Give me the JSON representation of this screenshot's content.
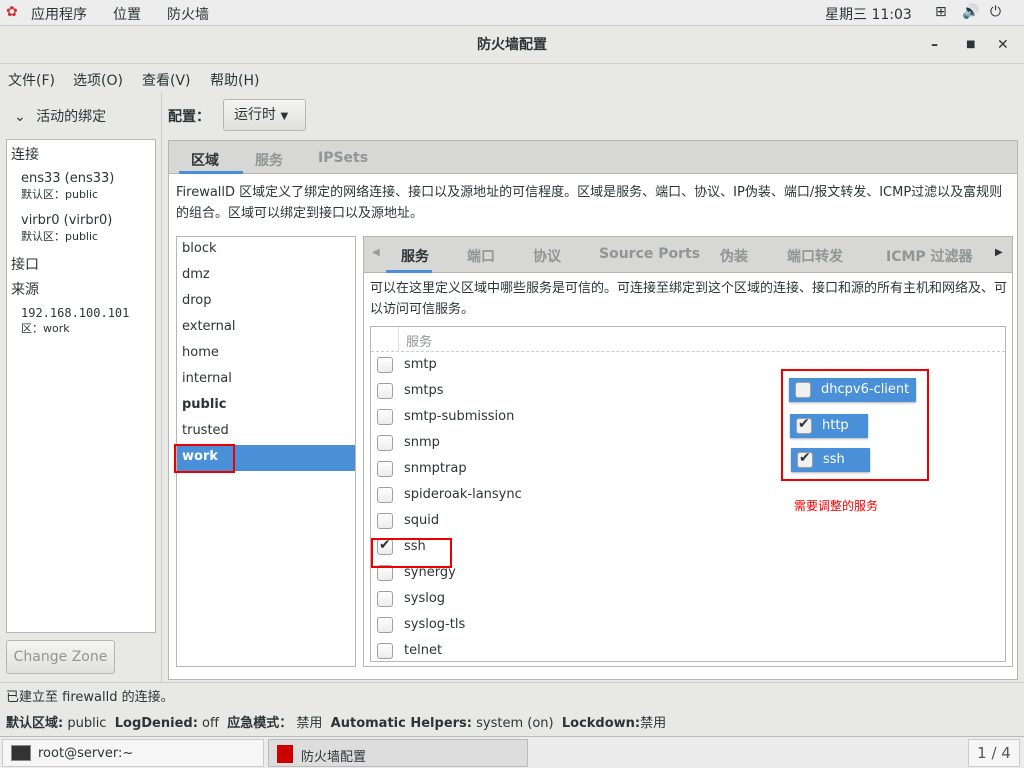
{
  "topbar": {
    "apps": "应用程序",
    "places": "位置",
    "app_name": "防火墙",
    "clock": "星期三 11:03"
  },
  "window": {
    "title": "防火墙配置"
  },
  "menu": [
    "文件(F)",
    "选项(O)",
    "查看(V)",
    "帮助(H)"
  ],
  "left": {
    "header": "活动的绑定",
    "connections_label": "连接",
    "connections": [
      {
        "name": "ens33 (ens33)",
        "zone": "默认区：public"
      },
      {
        "name": "virbr0 (virbr0)",
        "zone": "默认区：public"
      }
    ],
    "interfaces_label": "接口",
    "sources_label": "来源",
    "sources": [
      {
        "name": "192.168.100.101",
        "zone": "区：work"
      }
    ],
    "change_zone": "Change Zone"
  },
  "config": {
    "label": "配置：",
    "value": "运行时"
  },
  "main_tabs": [
    "区域",
    "服务",
    "IPSets"
  ],
  "zone_desc": "FirewallD 区域定义了绑定的网络连接、接口以及源地址的可信程度。区域是服务、端口、协议、IP伪装、端口/报文转发、ICMP过滤以及富规则的组合。区域可以绑定到接口以及源地址。",
  "zones": [
    "block",
    "dmz",
    "drop",
    "external",
    "home",
    "internal",
    "public",
    "trusted",
    "work"
  ],
  "selected_zone": "work",
  "inner_tabs": [
    "服务",
    "端口",
    "协议",
    "Source Ports",
    "伪装",
    "端口转发",
    "ICMP 过滤器"
  ],
  "service_desc": "可以在这里定义区域中哪些服务是可信的。可连接至绑定到这个区域的连接、接口和源的所有主机和网络及、可以访问可信服务。",
  "services_header": "服务",
  "services": [
    {
      "name": "smtp",
      "checked": false
    },
    {
      "name": "smtps",
      "checked": false
    },
    {
      "name": "smtp-submission",
      "checked": false
    },
    {
      "name": "snmp",
      "checked": false
    },
    {
      "name": "snmptrap",
      "checked": false
    },
    {
      "name": "spideroak-lansync",
      "checked": false
    },
    {
      "name": "squid",
      "checked": false
    },
    {
      "name": "ssh",
      "checked": true
    },
    {
      "name": "synergy",
      "checked": false
    },
    {
      "name": "syslog",
      "checked": false
    },
    {
      "name": "syslog-tls",
      "checked": false
    },
    {
      "name": "telnet",
      "checked": false
    }
  ],
  "annotation": {
    "items": [
      {
        "name": "dhcpv6-client",
        "checked": false
      },
      {
        "name": "http",
        "checked": true
      },
      {
        "name": "ssh",
        "checked": true
      }
    ],
    "note": "需要调整的服务",
    "color": "#e00000"
  },
  "status": {
    "line1": "已建立至 firewalld 的连接。",
    "default_zone_label": "默认区域:",
    "default_zone": "public",
    "logdenied_label": "LogDenied:",
    "logdenied": "off",
    "panic_label": "应急模式：",
    "panic": "禁用",
    "helpers_label": "Automatic Helpers:",
    "helpers": "system (on)",
    "lockdown_label": "Lockdown:",
    "lockdown": "禁用"
  },
  "taskbar": {
    "terminal": "root@server:~",
    "firewall": "防火墙配置",
    "workspace": "1 / 4"
  }
}
